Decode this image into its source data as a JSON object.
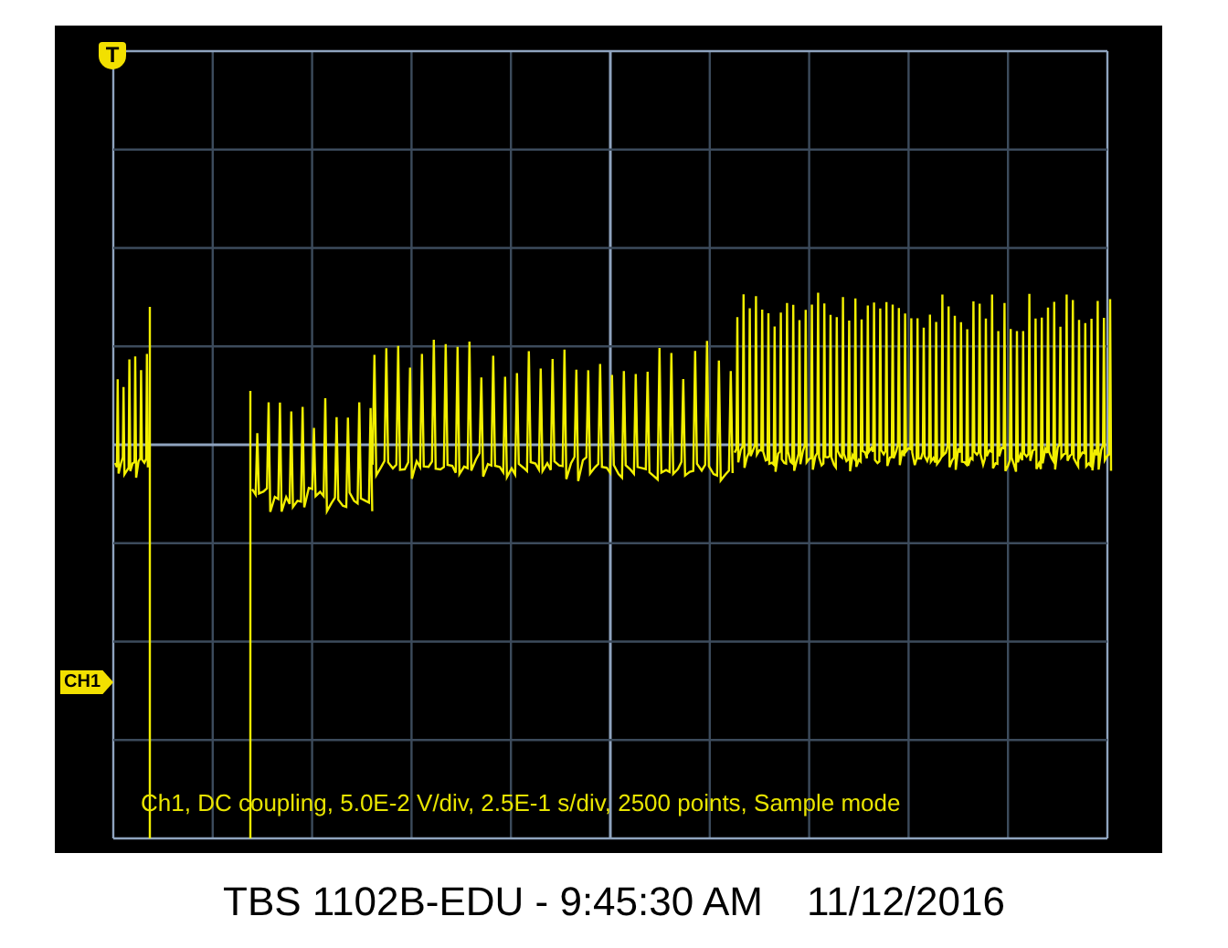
{
  "screen": {
    "trigger_marker": "T",
    "channel_marker": "CH1",
    "status_line": "Ch1, DC coupling, 5.0E-2 V/div, 2.5E-1 s/div, 2500 points, Sample mode"
  },
  "footer": {
    "title": "TBS 1102B-EDU - 9:45:30 AM",
    "date": "11/12/2016"
  }
}
